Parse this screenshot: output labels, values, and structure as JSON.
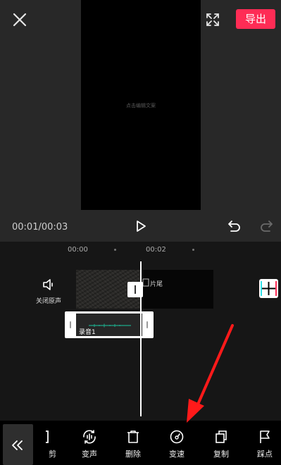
{
  "header": {
    "export_label": "导出"
  },
  "preview": {
    "canvas_hint": "点击编辑文案",
    "time_display": "00:01/00:03"
  },
  "timeline": {
    "ruler": [
      "00:00",
      "00:02"
    ],
    "mute_label": "关闭原声",
    "ending_label": "片尾",
    "audio_clip_name": "录音1"
  },
  "toolbar": {
    "items": [
      {
        "label": "剪",
        "icon": "split-icon"
      },
      {
        "label": "变声",
        "icon": "voice-change-icon"
      },
      {
        "label": "删除",
        "icon": "delete-icon"
      },
      {
        "label": "变速",
        "icon": "speed-icon"
      },
      {
        "label": "复制",
        "icon": "copy-icon"
      },
      {
        "label": "踩点",
        "icon": "beat-flag-icon"
      }
    ]
  },
  "colors": {
    "accent": "#fe2c55",
    "annotation": "#ff1a1a"
  }
}
